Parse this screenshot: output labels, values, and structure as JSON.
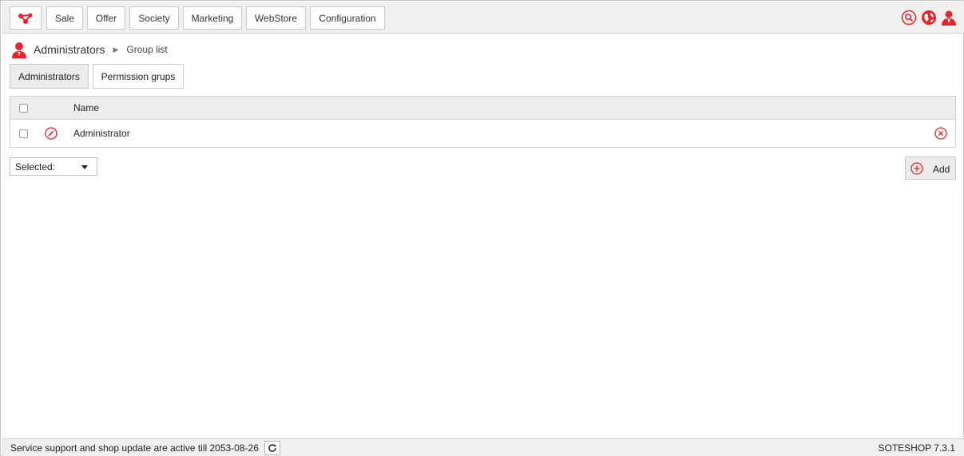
{
  "nav": {
    "items": [
      {
        "label": "Sale"
      },
      {
        "label": "Offer"
      },
      {
        "label": "Society"
      },
      {
        "label": "Marketing"
      },
      {
        "label": "WebStore"
      },
      {
        "label": "Configuration"
      }
    ],
    "icons": [
      "search-icon",
      "globe-icon",
      "user-icon"
    ],
    "accent": "#e3262b"
  },
  "breadcrumb": {
    "section": "Administrators",
    "page": "Group list"
  },
  "tabs": [
    {
      "label": "Administrators",
      "active": true
    },
    {
      "label": "Permission grups",
      "active": false
    }
  ],
  "table": {
    "columns": [
      "Name"
    ],
    "rows": [
      {
        "name": "Administrator"
      }
    ]
  },
  "actions": {
    "selected_label": "Selected:",
    "add_label": "Add"
  },
  "footer": {
    "status": "Service support and shop update are active till 2053-08-26",
    "version": "SOTESHOP 7.3.1"
  }
}
